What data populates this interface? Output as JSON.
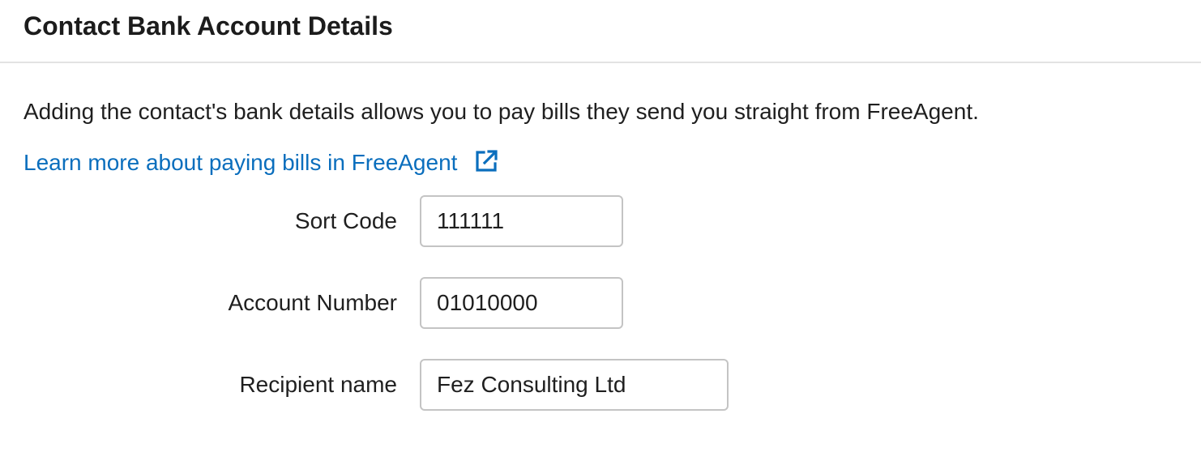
{
  "panel": {
    "title": "Contact Bank Account Details",
    "intro": "Adding the contact's bank details allows you to pay bills they send you straight from FreeAgent.",
    "learn_more_link": "Learn more about paying bills in FreeAgent",
    "link_color": "#0a6ebd"
  },
  "form": {
    "sort_code": {
      "label": "Sort Code",
      "value": "111111"
    },
    "account_number": {
      "label": "Account Number",
      "value": "01010000"
    },
    "recipient_name": {
      "label": "Recipient name",
      "value": "Fez Consulting Ltd"
    }
  },
  "icons": {
    "learn_more": "external-link-icon"
  }
}
